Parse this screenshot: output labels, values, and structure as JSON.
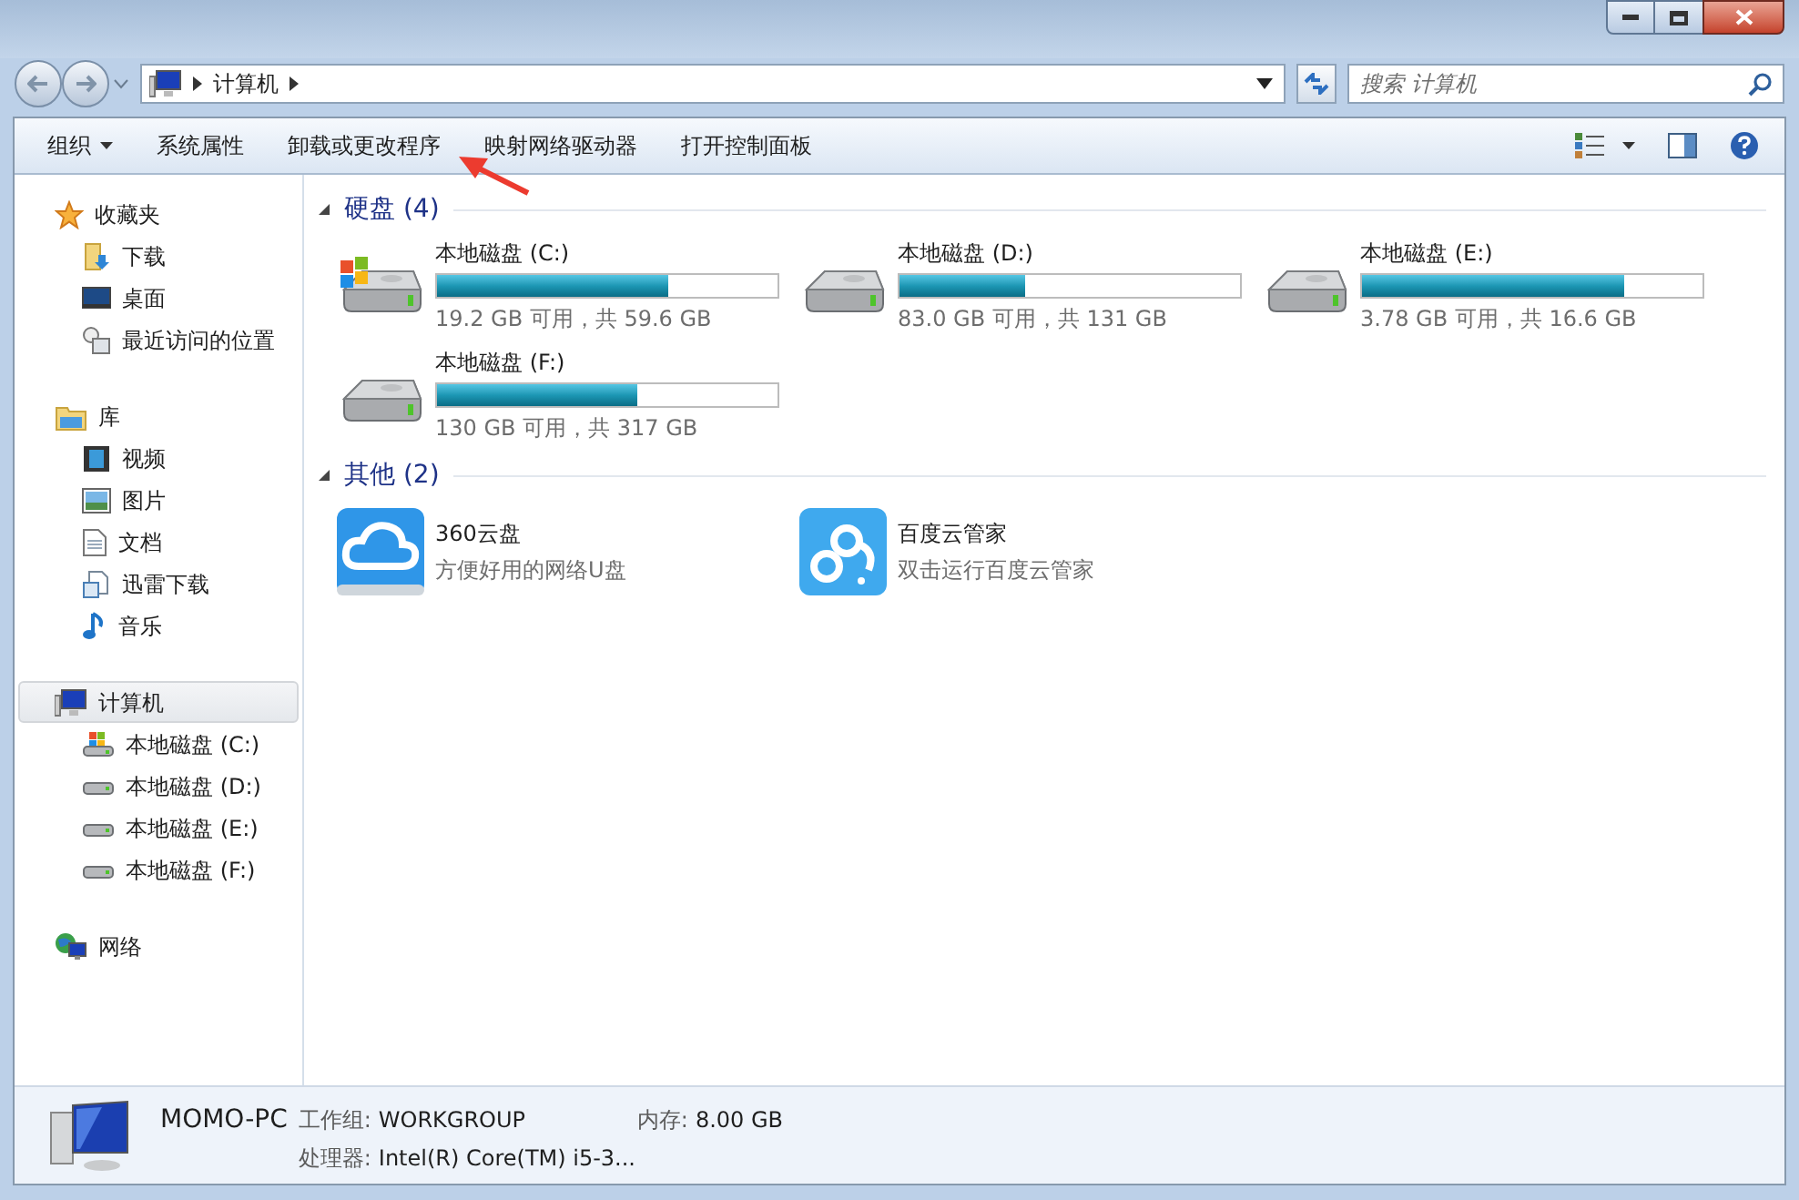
{
  "address_bar": {
    "path": [
      "计算机"
    ],
    "search_placeholder": "搜索 计算机"
  },
  "toolbar": {
    "items": [
      "组织",
      "系统属性",
      "卸载或更改程序",
      "映射网络驱动器",
      "打开控制面板"
    ]
  },
  "sidebar": {
    "groups": [
      {
        "label": "收藏夹",
        "kind": "star",
        "selected": false,
        "children": [
          {
            "label": "下载",
            "kind": "download"
          },
          {
            "label": "桌面",
            "kind": "desktop"
          },
          {
            "label": "最近访问的位置",
            "kind": "recent"
          }
        ]
      },
      {
        "label": "库",
        "kind": "library",
        "selected": false,
        "children": [
          {
            "label": "视频",
            "kind": "video"
          },
          {
            "label": "图片",
            "kind": "image"
          },
          {
            "label": "文档",
            "kind": "doc"
          },
          {
            "label": "迅雷下载",
            "kind": "doc2"
          },
          {
            "label": "音乐",
            "kind": "music"
          }
        ]
      },
      {
        "label": "计算机",
        "kind": "computer",
        "selected": true,
        "children": [
          {
            "label": "本地磁盘 (C:)",
            "kind": "sysdrive"
          },
          {
            "label": "本地磁盘 (D:)",
            "kind": "drive"
          },
          {
            "label": "本地磁盘 (E:)",
            "kind": "drive"
          },
          {
            "label": "本地磁盘 (F:)",
            "kind": "drive"
          }
        ]
      },
      {
        "label": "网络",
        "kind": "network",
        "selected": false
      }
    ]
  },
  "sections": [
    {
      "title": "硬盘 (4)",
      "items": [
        {
          "kind": "sysdrive",
          "name": "本地磁盘 (C:)",
          "level": 0.68,
          "caption": "19.2 GB 可用，共 59.6 GB"
        },
        {
          "kind": "drive",
          "name": "本地磁盘 (D:)",
          "level": 0.37,
          "caption": "83.0 GB 可用，共 131 GB"
        },
        {
          "kind": "drive",
          "name": "本地磁盘 (E:)",
          "level": 0.77,
          "caption": "3.78 GB 可用，共 16.6 GB"
        },
        {
          "kind": "drive",
          "name": "本地磁盘 (F:)",
          "level": 0.59,
          "caption": "130 GB 可用，共 317 GB"
        }
      ]
    },
    {
      "title": "其他 (2)",
      "items": [
        {
          "kind": "cloud360",
          "name": "360云盘",
          "caption": "方便好用的网络U盘"
        },
        {
          "kind": "baidu",
          "name": "百度云管家",
          "caption": "双击运行百度云管家"
        }
      ]
    }
  ],
  "details": {
    "computer_name": "MOMO-PC",
    "fields": [
      {
        "label": "工作组:",
        "value": "WORKGROUP"
      },
      {
        "label": "内存:",
        "value": "8.00 GB"
      },
      {
        "label": "处理器:",
        "value": "Intel(R) Core(TM) i5-3..."
      }
    ]
  }
}
